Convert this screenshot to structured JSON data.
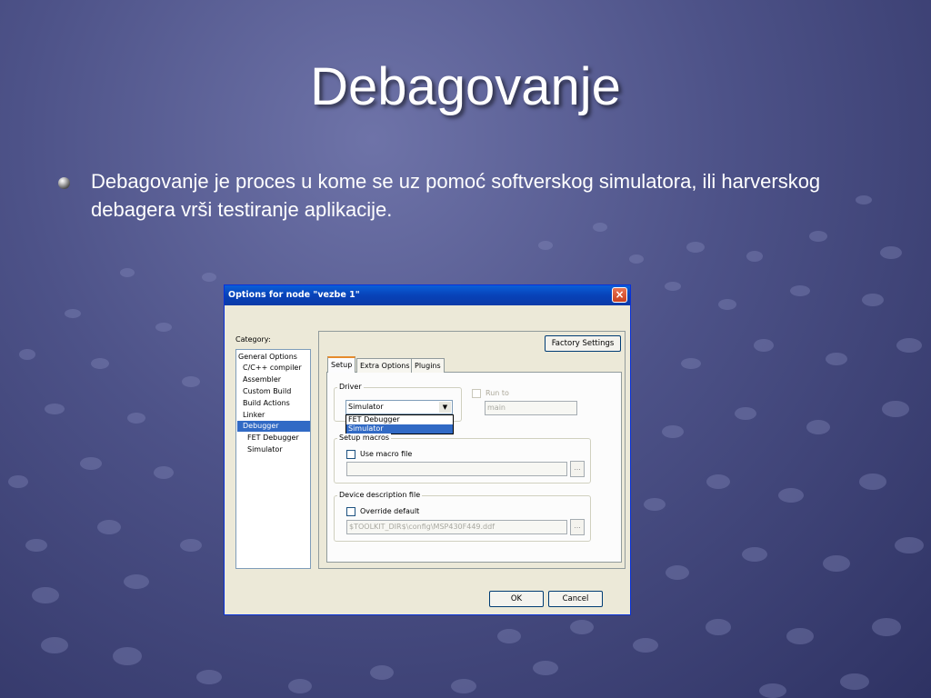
{
  "slide": {
    "title": "Debagovanje",
    "bullet": "Debagovanje je proces u kome se uz pomoć softverskog simulatora, ili harverskog debagera vrši testiranje aplikacije."
  },
  "dialog": {
    "title": "Options for node \"vezbe 1\"",
    "close_icon": "×",
    "category_label": "Category:",
    "categories": [
      "General Options",
      "C/C++ compiler",
      "Assembler",
      "Custom Build",
      "Build Actions",
      "Linker",
      "Debugger",
      "FET Debugger",
      "Simulator"
    ],
    "selected_category": "Debugger",
    "factory_settings": "Factory Settings",
    "tabs": [
      "Setup",
      "Extra Options",
      "Plugins"
    ],
    "driver": {
      "label": "Driver",
      "value": "Simulator",
      "options": [
        "FET Debugger",
        "Simulator"
      ]
    },
    "run_to": {
      "label": "Run to",
      "value": "main"
    },
    "setup_macros": {
      "label": "Setup macros",
      "checkbox": "Use macro file",
      "browse": "..."
    },
    "device_description": {
      "label": "Device description file",
      "checkbox": "Override default",
      "path": "$TOOLKIT_DIR$\\config\\MSP430F449.ddf",
      "browse": "..."
    },
    "ok": "OK",
    "cancel": "Cancel"
  },
  "colors": {
    "accent": "#316ac5",
    "titlebar": "#0842b8",
    "background": "#4d5288"
  }
}
